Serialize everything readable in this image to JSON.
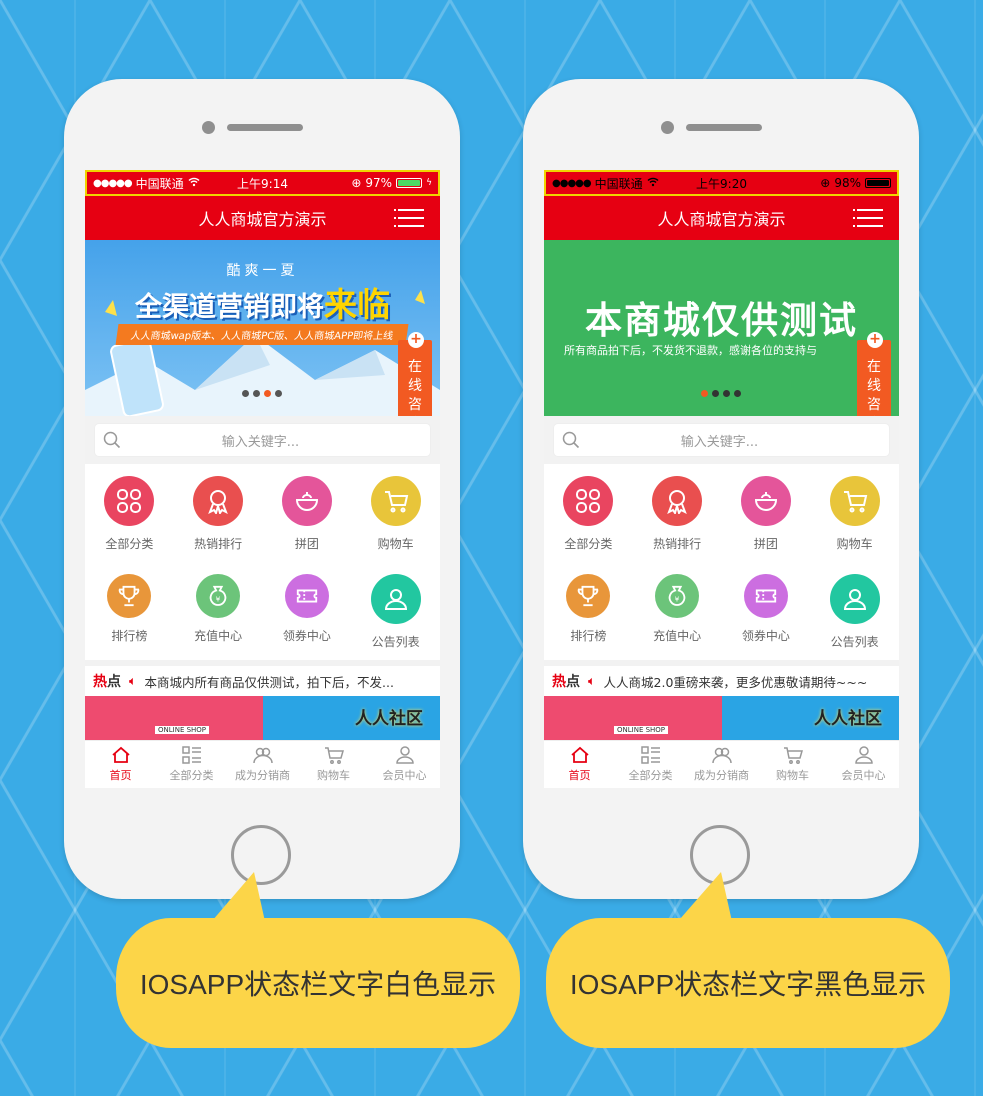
{
  "phones": [
    {
      "status": {
        "carrier": "中国联通",
        "time": "上午9:14",
        "battery": "97%",
        "battery_level": 0.97,
        "text_color": "#ffffff"
      },
      "nav_title": "人人商城官方演示",
      "banner": {
        "subtitle": "酷爽一夏",
        "headline": "全渠道营销即将",
        "headline_em": "来临",
        "tagline": "人人商城wap版本、人人商城PC版、人人商城APP即将上线"
      },
      "float": [
        "在",
        "线",
        "咨",
        "询"
      ],
      "search_placeholder": "输入关键字...",
      "grid": [
        {
          "label": "全部分类",
          "icon": "grid-icon",
          "color": "#e94560"
        },
        {
          "label": "热销排行",
          "icon": "medal-icon",
          "color": "#e94f4f"
        },
        {
          "label": "拼团",
          "icon": "bowl-icon",
          "color": "#e4559a"
        },
        {
          "label": "购物车",
          "icon": "cart-icon",
          "color": "#e8c53a"
        },
        {
          "label": "排行榜",
          "icon": "trophy-icon",
          "color": "#e8963a"
        },
        {
          "label": "充值中心",
          "icon": "money-bag-icon",
          "color": "#6cc47a"
        },
        {
          "label": "领券中心",
          "icon": "coupon-icon",
          "color": "#cc6ee0"
        },
        {
          "label": "公告列表",
          "icon": "user-icon",
          "color": "#22c7a0"
        }
      ],
      "hot": {
        "a": "热",
        "b": "点"
      },
      "notice": "本商城内所有商品仅供测试，拍下后，不发...",
      "strip": {
        "shop": "ONLINE SHOP",
        "title": "人人社区"
      },
      "tabs": [
        "首页",
        "全部分类",
        "成为分销商",
        "购物车",
        "会员中心"
      ]
    },
    {
      "status": {
        "carrier": "中国联通",
        "time": "上午9:20",
        "battery": "98%",
        "battery_level": 0.98,
        "text_color": "#000000"
      },
      "nav_title": "人人商城官方演示",
      "banner": {
        "headline": "本商城仅供测试",
        "tagline": "所有商品拍下后，不发货不退款，感谢各位的支持与"
      },
      "float": [
        "在",
        "线",
        "咨",
        "询"
      ],
      "search_placeholder": "输入关键字...",
      "grid": [
        {
          "label": "全部分类",
          "icon": "grid-icon",
          "color": "#e94560"
        },
        {
          "label": "热销排行",
          "icon": "medal-icon",
          "color": "#e94f4f"
        },
        {
          "label": "拼团",
          "icon": "bowl-icon",
          "color": "#e4559a"
        },
        {
          "label": "购物车",
          "icon": "cart-icon",
          "color": "#e8c53a"
        },
        {
          "label": "排行榜",
          "icon": "trophy-icon",
          "color": "#e8963a"
        },
        {
          "label": "充值中心",
          "icon": "money-bag-icon",
          "color": "#6cc47a"
        },
        {
          "label": "领券中心",
          "icon": "coupon-icon",
          "color": "#cc6ee0"
        },
        {
          "label": "公告列表",
          "icon": "user-icon",
          "color": "#22c7a0"
        }
      ],
      "hot": {
        "a": "热",
        "b": "点"
      },
      "notice": "人人商城2.0重磅来袭，更多优惠敬请期待~~~",
      "strip": {
        "shop": "ONLINE SHOP",
        "title": "人人社区"
      },
      "tabs": [
        "首页",
        "全部分类",
        "成为分销商",
        "购物车",
        "会员中心"
      ]
    }
  ],
  "captions": [
    "IOSAPP状态栏文字白色显示",
    "IOSAPP状态栏文字黑色显示"
  ],
  "colors": {
    "accent": "#e60012",
    "background": "#3aabe6",
    "bubble": "#fcd548",
    "banner2": "#3cb55e"
  }
}
